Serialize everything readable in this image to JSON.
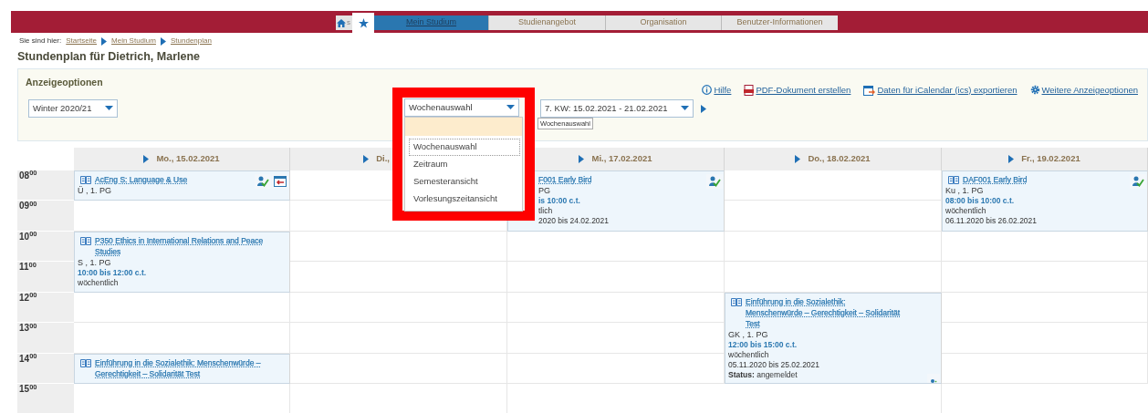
{
  "nav": {
    "home_label": "s",
    "tabs": [
      {
        "label": "Mein Studium",
        "selected": true
      },
      {
        "label": "Studienangebot",
        "selected": false
      },
      {
        "label": "Organisation",
        "selected": false
      },
      {
        "label": "Benutzer-Informationen",
        "selected": false
      }
    ]
  },
  "breadcrumb": {
    "prefix": "Sie sind hier:",
    "items": [
      "Startseite",
      "Mein Studium",
      "Stundenplan"
    ]
  },
  "title": "Stundenplan für Dietrich, Marlene",
  "options": {
    "heading": "Anzeigeoptionen",
    "links": [
      {
        "kind": "help",
        "label": "Hilfe"
      },
      {
        "kind": "pdf",
        "label": "PDF-Dokument erstellen"
      },
      {
        "kind": "ical",
        "label": "Daten für iCalendar (ics) exportieren"
      },
      {
        "kind": "settings",
        "label": "Weitere Anzeigeoptionen"
      }
    ],
    "semester": "Winter 2020/21",
    "view": "Wochenauswahl",
    "week": "7. KW: 15.02.2021 - 21.02.2021",
    "dropdown": {
      "tooltip": "Wochenauswahl",
      "items": [
        {
          "label": "Wochenauswahl",
          "selected": true
        },
        {
          "label": "Zeitraum",
          "selected": false
        },
        {
          "label": "Semesteransicht",
          "selected": false
        },
        {
          "label": "Vorlesungszeitansicht",
          "selected": false
        }
      ]
    }
  },
  "hours": [
    "08$^{00}$",
    "09$^{00}$",
    "10$^{00}$",
    "11$^{00}$",
    "12$^{00}$",
    "13$^{00}$",
    "14$^{00}$",
    "15$^{00}$"
  ],
  "days": [
    {
      "label": "Mo., 15.02.2021",
      "covered": false,
      "cells": [
        {
          "kind": "event",
          "covered": false,
          "title": "AcEng S: Language & Use",
          "lines": [
            "Ü , 1. PG"
          ],
          "actions": [
            {
              "kind": "enroll"
            },
            {
              "kind": "remove"
            }
          ]
        },
        {
          "kind": "empty"
        },
        {
          "kind": "event",
          "covered": false,
          "title": "P350 Ethics in International Relations and Peace Studies",
          "lines": [
            "S , 1. PG"
          ],
          "time": "10:00 bis 12:00 c.t.",
          "after": [
            "wöchentlich"
          ]
        },
        {
          "kind": "continued"
        },
        {
          "kind": "empty"
        },
        {
          "kind": "empty"
        },
        {
          "kind": "event",
          "covered": false,
          "title": "Einführung in die Sozialethik: Menschenwürde – Gerechtigkeit – Solidarität Test"
        },
        {
          "kind": "empty"
        }
      ]
    },
    {
      "label": "Di.,",
      "covered": true,
      "cells": [
        {
          "kind": "empty"
        },
        {
          "kind": "empty"
        },
        {
          "kind": "empty"
        },
        {
          "kind": "empty"
        },
        {
          "kind": "empty"
        },
        {
          "kind": "empty"
        },
        {
          "kind": "empty"
        },
        {
          "kind": "empty"
        }
      ]
    },
    {
      "label": "Mi., 17.02.2021",
      "covered": false,
      "cells": [
        {
          "kind": "event",
          "covered": true,
          "title": "F001 Early Bird",
          "lines": [
            "PG"
          ],
          "time": "is 10:00 c.t.",
          "after": [
            "tlich",
            "2020 bis 24.02.2021"
          ],
          "actions": [
            {
              "kind": "enroll"
            }
          ]
        },
        {
          "kind": "continued"
        },
        {
          "kind": "empty"
        },
        {
          "kind": "empty"
        },
        {
          "kind": "empty"
        },
        {
          "kind": "empty"
        },
        {
          "kind": "empty"
        }
      ]
    },
    {
      "label": "Do., 18.02.2021",
      "covered": false,
      "cells": [
        {
          "kind": "empty"
        },
        {
          "kind": "empty"
        },
        {
          "kind": "empty"
        },
        {
          "kind": "empty"
        },
        {
          "kind": "event",
          "covered": false,
          "title": "Einführung in die Sozialethik: Menschenwürde – Gerechtigkeit – Solidarität Test",
          "lines": [
            "GK , 1. PG"
          ],
          "time": "12:00 bis 15:00 c.t.",
          "after": [
            "wöchentlich",
            "05.11.2020 bis 25.02.2021",
            "**Status:** angemeldet"
          ],
          "actions": [
            {
              "kind": "enroll-small"
            }
          ]
        },
        {
          "kind": "continued"
        },
        {
          "kind": "continued"
        },
        {
          "kind": "empty"
        }
      ]
    },
    {
      "label": "Fr., 19.02.2021",
      "covered": false,
      "cells": [
        {
          "kind": "event",
          "covered": false,
          "title": "DAF001 Early Bird",
          "lines": [
            "Ku , 1. PG"
          ],
          "time": "08:00 bis 10:00 c.t.",
          "after": [
            "wöchentlich",
            "06.11.2020 bis 26.02.2021"
          ],
          "actions": [
            {
              "kind": "enroll"
            }
          ]
        },
        {
          "kind": "continued"
        },
        {
          "kind": "empty"
        },
        {
          "kind": "empty"
        },
        {
          "kind": "empty"
        },
        {
          "kind": "empty"
        },
        {
          "kind": "empty"
        }
      ]
    }
  ]
}
